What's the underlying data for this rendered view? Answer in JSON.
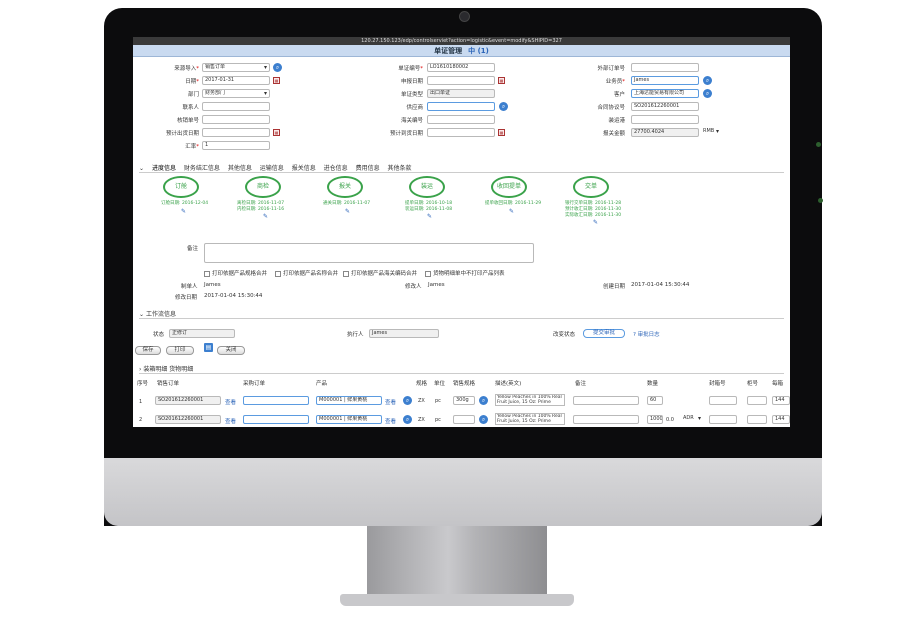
{
  "url": "120.27.150.123/edp/controlserviet?action=logistic&event=modify&SHIPID=327",
  "title": "单证管理",
  "title_icon": "中",
  "title_count": "(1)",
  "form": {
    "source_label": "来源导入",
    "source_value": "销售订单",
    "date_label": "日期",
    "date_value": "2017-01-31",
    "dept_label": "部门",
    "dept_value": "财务部门",
    "contact_label": "联系人",
    "verify_label": "核销单号",
    "est_ship_label": "预计出货日期",
    "rate_label": "汇率",
    "rate_value": "1",
    "docno_label": "单证编号",
    "docno_value": "LO1610180002",
    "apply_date_label": "申报日期",
    "doctype_label": "单证类型",
    "doctype_value": "出口单证",
    "supplier_label": "供应商",
    "customs_label": "海关编号",
    "est_arrive_label": "预计到货日期",
    "ext_order_label": "外部订单号",
    "sales_label": "业务员",
    "sales_value": "James",
    "customer_label": "客户",
    "customer_value": "上海达能贸易有限公司",
    "contract_label": "合同协议号",
    "contract_value": "SO201612260001",
    "port_label": "装运港",
    "amount_label": "报关金额",
    "amount_value": "27700.4024",
    "currency_value": "RMB"
  },
  "tabs": [
    "进度信息",
    "财务结汇信息",
    "其他信息",
    "运输信息",
    "报关信息",
    "进仓信息",
    "费用信息",
    "其他条款"
  ],
  "stages": [
    {
      "name": "订舱",
      "info": [
        "订舱日期: 2016-12-04"
      ]
    },
    {
      "name": "商检",
      "info": [
        "离检日期: 2016-11-07",
        "内检日期: 2016-11-16"
      ]
    },
    {
      "name": "报关",
      "info": [
        "通关日期: 2016-11-07"
      ]
    },
    {
      "name": "装运",
      "info": [
        "提单日期: 2016-10-18",
        "装运日期: 2016-11-08"
      ]
    },
    {
      "name": "收回提单",
      "info": [
        "提单收回日期: 2016-11-29"
      ]
    },
    {
      "name": "交单",
      "info": [
        "银行交单日期: 2016-11-28",
        "预计收汇日期: 2016-11-30",
        "实际收汇日期: 2016-11-30"
      ]
    }
  ],
  "remarks_label": "备注",
  "checks": [
    "打印依据产品规格合并",
    "打印依据产品名称合并",
    "打印依据产品海关编码合并",
    "货物明细单中不打印产品列表"
  ],
  "maker_label": "制单人",
  "maker_value": "James",
  "modifier_label": "修改人",
  "modifier_value": "James",
  "create_date_label": "创建日期",
  "create_date_value": "2017-01-04 15:30:44",
  "modify_date_label": "修改日期",
  "modify_date_value": "2017-01-04 15:30:44",
  "workflow_title": "工作流信息",
  "status_label": "状态",
  "status_value": "正修订",
  "executor_label": "执行人",
  "executor_value": "James",
  "change_status_label": "改变状态",
  "submit_btn": "提交审批",
  "audit_log": "审批日志",
  "buttons": {
    "save": "保存",
    "print": "打印",
    "close": "关闭"
  },
  "detail_tabs": [
    "装箱明细",
    "货物明细"
  ],
  "columns": [
    "序号",
    "销售订单",
    "采购订单",
    "产品",
    "规格",
    "单位",
    "销售规格",
    "描述(英文)",
    "备注",
    "数量",
    "封箱号",
    "柜号",
    "每箱"
  ],
  "rows": [
    {
      "no": "1",
      "so": "SO201612260001",
      "view": "查看",
      "product": "M000001 | 鲜果黄桃",
      "spec": "ZX",
      "unit": "pc",
      "sale_spec": "300g",
      "desc": "Yellow Peaches in 100% Real Fruit Juice, 15 Oz: Prime",
      "qty": "60",
      "per": "144"
    },
    {
      "no": "2",
      "so": "SO201612260001",
      "view": "查看",
      "product": "M000001 | 鲜果黄桃",
      "spec": "ZX",
      "unit": "pc",
      "sale_spec": "",
      "desc": "Yellow Peaches in 100% Real Fruit Juice, 15 Oz: Prime",
      "qty": "1000",
      "qty2": "0.0",
      "cur": "ADR",
      "per": "144"
    }
  ]
}
